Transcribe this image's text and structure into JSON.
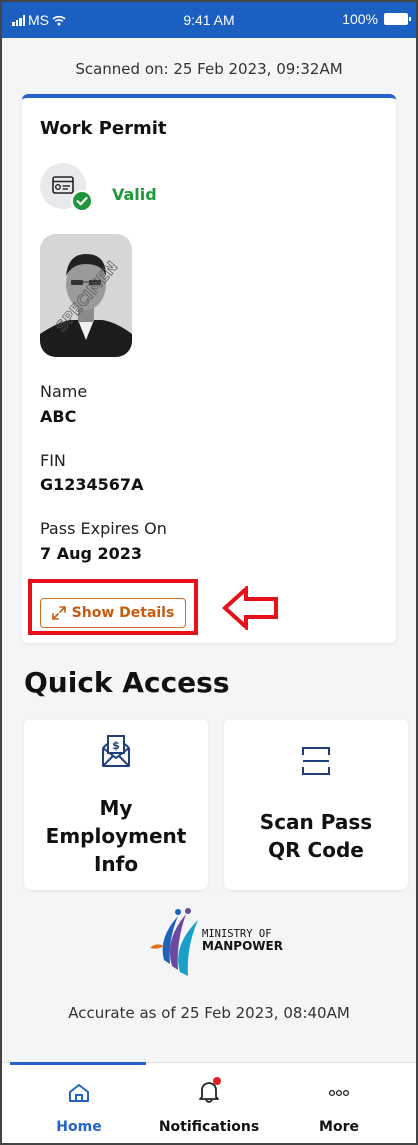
{
  "status_bar": {
    "carrier": "MS",
    "time": "9:41 AM",
    "battery": "100%"
  },
  "scanned_on": "Scanned on: 25 Feb 2023, 09:32AM",
  "permit_card": {
    "title": "Work Permit",
    "status": "Valid",
    "status_color": "#1e9a38",
    "accent_color": "#2563c9",
    "photo_watermark": "SPECIMEN",
    "fields": [
      {
        "label": "Name",
        "value": "ABC"
      },
      {
        "label": "FIN",
        "value": "G1234567A"
      },
      {
        "label": "Pass Expires On",
        "value": "7 Aug 2023"
      }
    ],
    "show_details_label": "Show Details",
    "show_details_color": "#c85a10"
  },
  "quick_access": {
    "title": "Quick Access",
    "tiles": [
      {
        "icon": "salary-envelope-icon",
        "label_lines": [
          "My",
          "Employment",
          "Info"
        ]
      },
      {
        "icon": "scan-frame-icon",
        "label_lines": [
          "Scan Pass",
          "QR Code"
        ]
      }
    ]
  },
  "logo": {
    "line1": "MINISTRY OF",
    "line2": "MANPOWER"
  },
  "accurate_as_of": "Accurate as of 25 Feb 2023, 08:40AM",
  "bottom_nav": {
    "items": [
      {
        "label": "Home",
        "icon": "home-icon",
        "active": true
      },
      {
        "label": "Notifications",
        "icon": "bell-icon",
        "active": false
      },
      {
        "label": "More",
        "icon": "more-dots-icon",
        "active": false
      }
    ],
    "active_color": "#2563c9"
  },
  "annotation_color": "#e8101a"
}
